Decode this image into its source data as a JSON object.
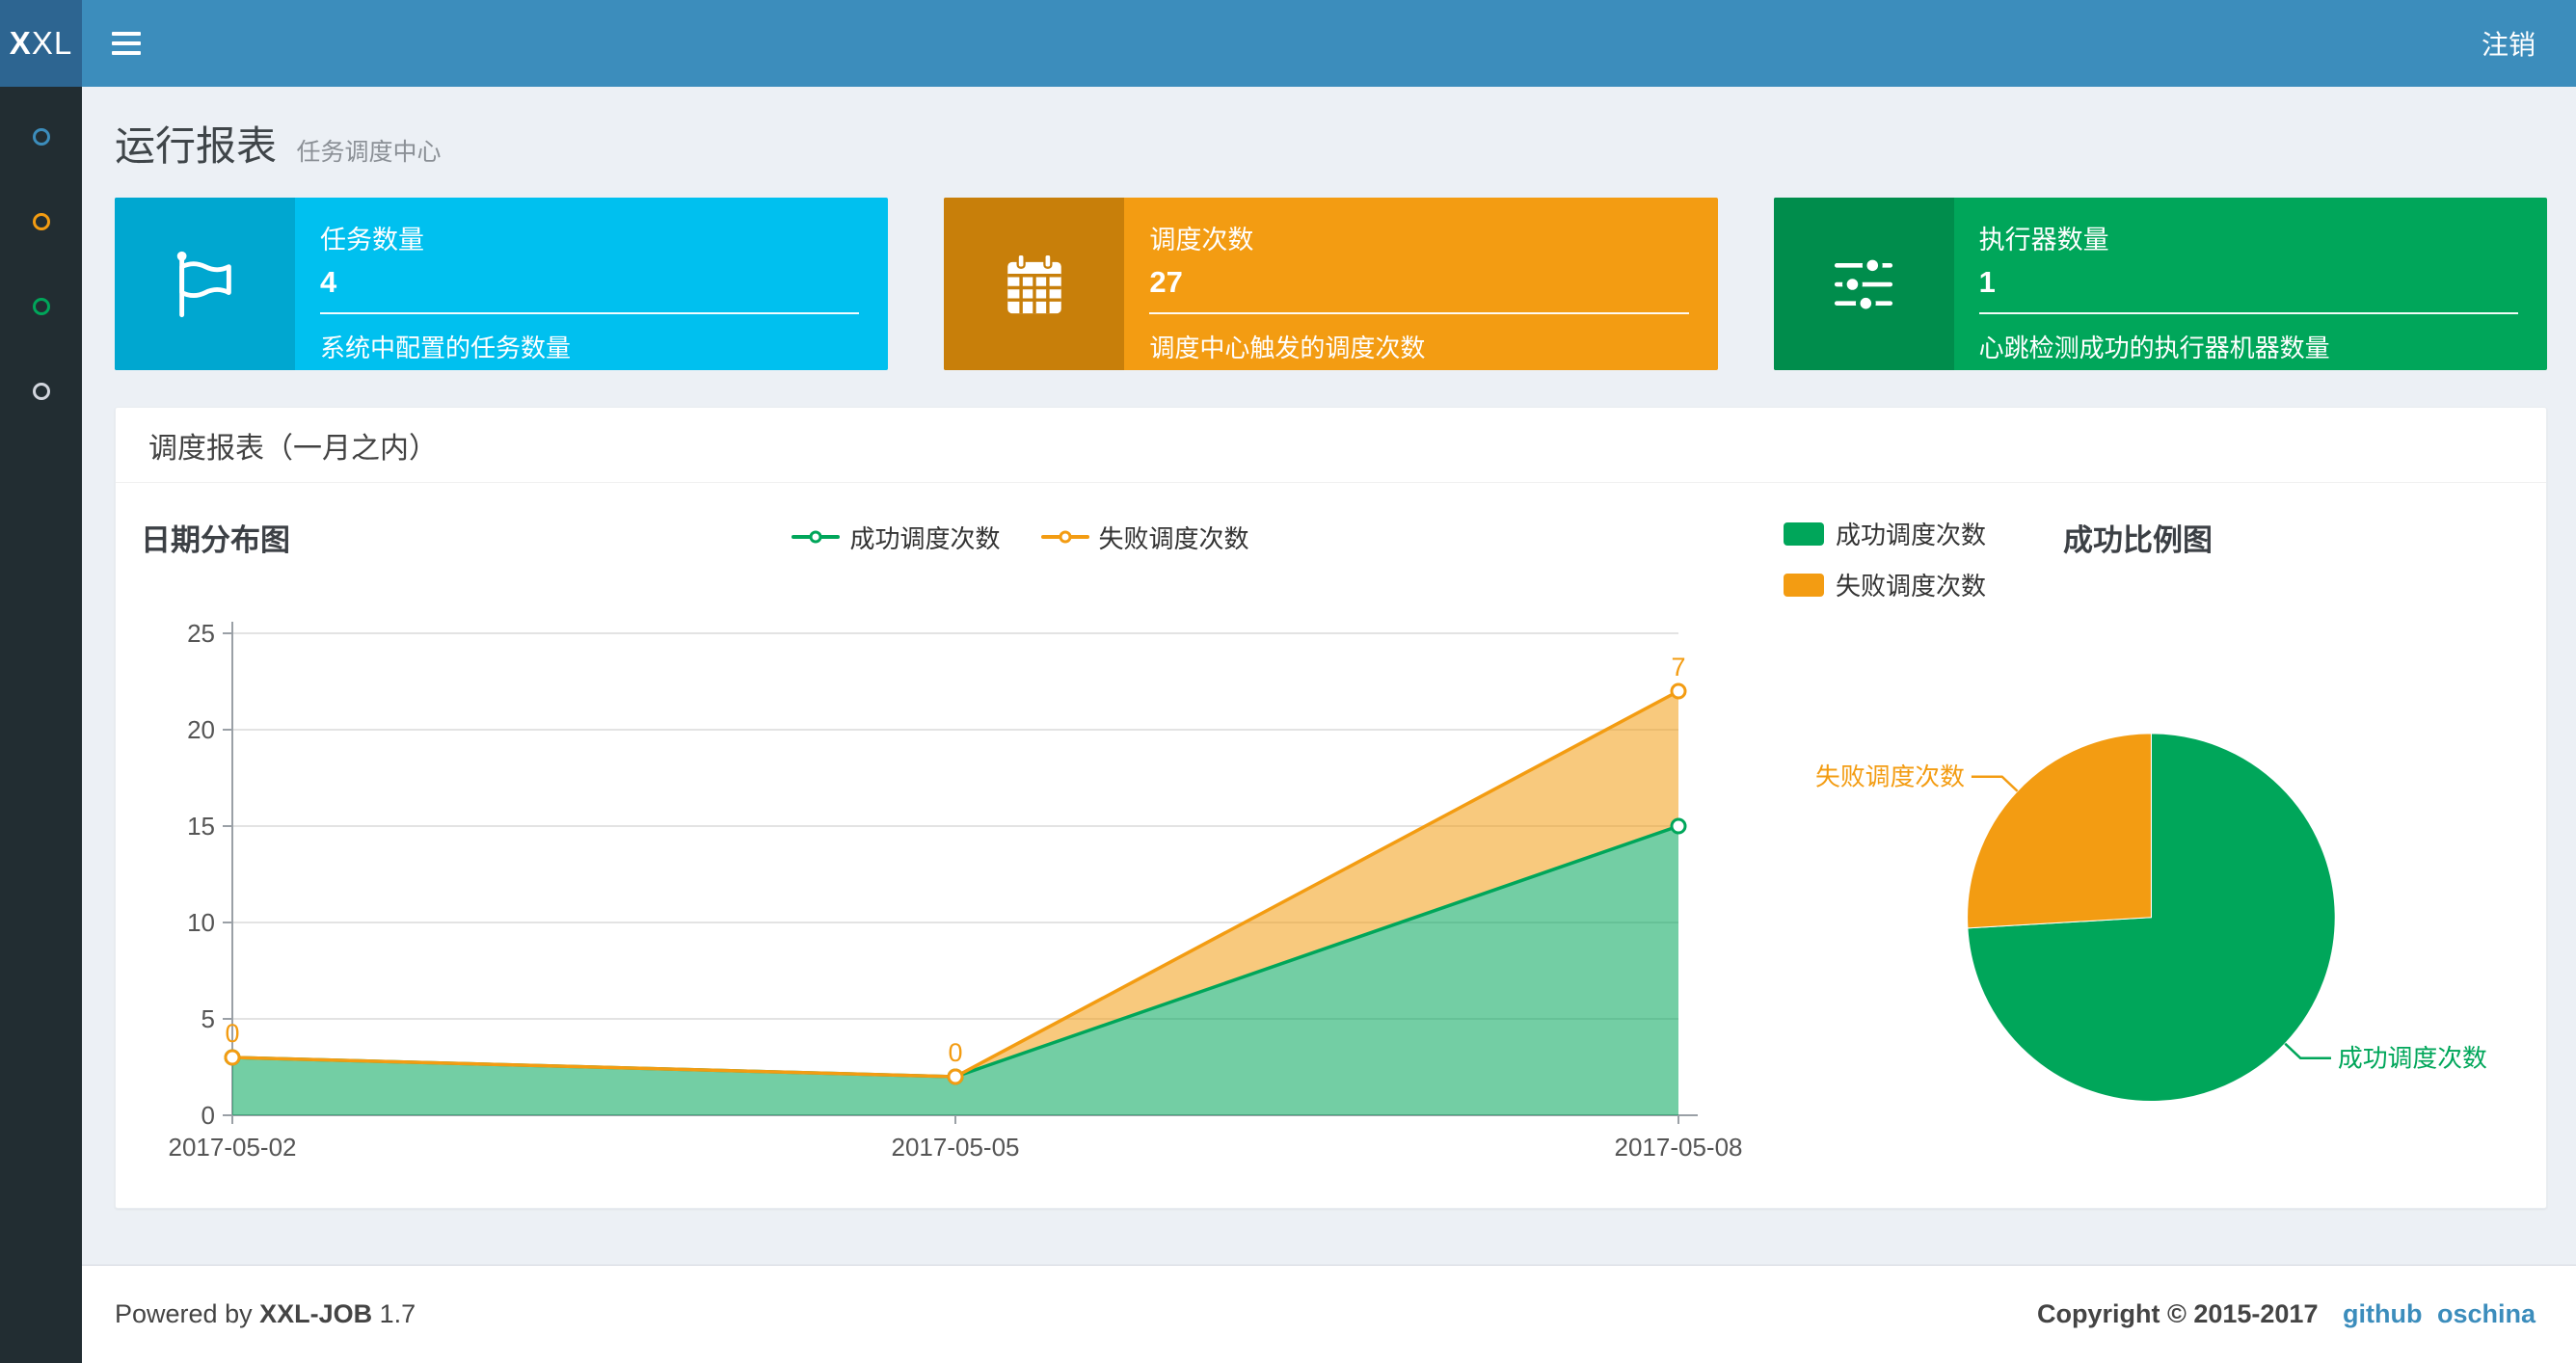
{
  "colors": {
    "navbar": "#3c8dbc",
    "logo_bg": "#2d6591",
    "sidebar_bg": "#222d32",
    "body_bg": "#ecf0f5",
    "success": "#00a65a",
    "fail": "#f39c12",
    "info": "#00c0ef",
    "link": "#3c8dbc"
  },
  "navbar": {
    "logo_bold": "X",
    "logo_rest": "XL",
    "logout_label": "注销"
  },
  "sidebar": {
    "items": [
      {
        "name": "menu-1",
        "color": "#3c8dbc"
      },
      {
        "name": "menu-2",
        "color": "#f39c12"
      },
      {
        "name": "menu-3",
        "color": "#00a65a"
      },
      {
        "name": "menu-4",
        "color": "#d2d6de"
      }
    ]
  },
  "page_header": {
    "title": "运行报表",
    "subtitle": "任务调度中心"
  },
  "info_boxes": [
    {
      "title": "任务数量",
      "number": "4",
      "desc": "系统中配置的任务数量",
      "color": "#00c0ef",
      "icon_bg": "#00a7d0",
      "icon": "flag"
    },
    {
      "title": "调度次数",
      "number": "27",
      "desc": "调度中心触发的调度次数",
      "color": "#f39c12",
      "icon_bg": "#c87f0a",
      "icon": "calendar"
    },
    {
      "title": "执行器数量",
      "number": "1",
      "desc": "心跳检测成功的执行器机器数量",
      "color": "#00a65a",
      "icon_bg": "#008d4c",
      "icon": "sliders"
    }
  ],
  "panel": {
    "title": "调度报表（一月之内）"
  },
  "chart_data": [
    {
      "type": "area",
      "title": "日期分布图",
      "x": [
        "2017-05-02",
        "2017-05-05",
        "2017-05-08"
      ],
      "series": [
        {
          "name": "成功调度次数",
          "values": [
            3,
            2,
            15
          ],
          "color": "#00a65a"
        },
        {
          "name": "失败调度次数",
          "values": [
            0,
            0,
            7
          ],
          "color": "#f39c12"
        }
      ],
      "stacked": true,
      "ylim": [
        0,
        25
      ],
      "yticks": [
        0,
        5,
        10,
        15,
        20,
        25
      ],
      "fail_point_labels": [
        "0",
        "0",
        "7"
      ],
      "legend_position": "top-center",
      "grid": true
    },
    {
      "type": "pie",
      "title": "成功比例图",
      "slices": [
        {
          "name": "成功调度次数",
          "value": 20,
          "color": "#00a65a"
        },
        {
          "name": "失败调度次数",
          "value": 7,
          "color": "#f39c12"
        }
      ],
      "legend": [
        "成功调度次数",
        "失败调度次数"
      ],
      "start_angle_deg": 0,
      "direction": "clockwise"
    }
  ],
  "footer": {
    "powered_prefix": "Powered by",
    "brand": "XXL-JOB",
    "version": "1.7",
    "copyright": "Copyright © 2015-2017",
    "links": [
      "github",
      "oschina"
    ]
  }
}
